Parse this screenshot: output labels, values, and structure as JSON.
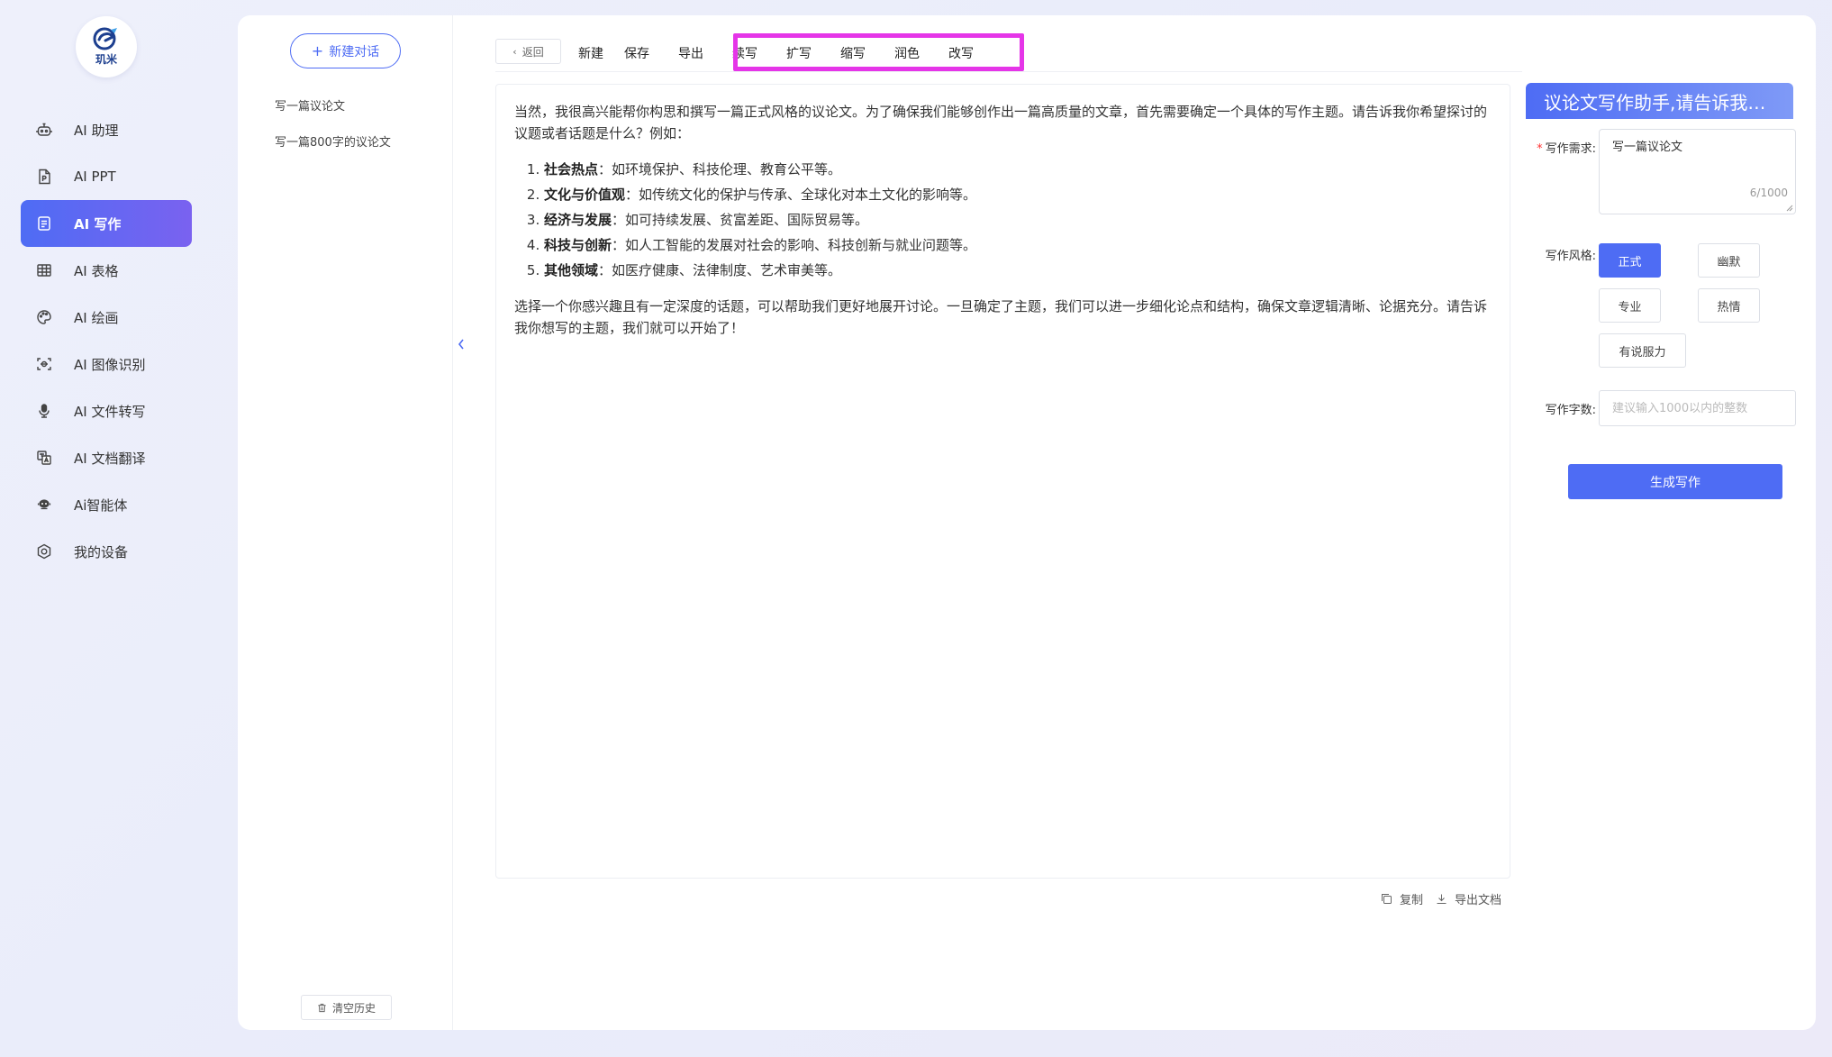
{
  "logo": {
    "text": "玑米"
  },
  "nav": {
    "items": [
      {
        "label": "AI 助理",
        "icon": "robot-icon"
      },
      {
        "label": "AI PPT",
        "icon": "ppt-file-icon"
      },
      {
        "label": "AI 写作",
        "icon": "document-edit-icon",
        "active": true
      },
      {
        "label": "AI 表格",
        "icon": "table-icon"
      },
      {
        "label": "AI 绘画",
        "icon": "palette-icon"
      },
      {
        "label": "AI 图像识别",
        "icon": "image-scan-icon"
      },
      {
        "label": "AI 文件转写",
        "icon": "microphone-file-icon"
      },
      {
        "label": "AI 文档翻译",
        "icon": "translate-icon"
      },
      {
        "label": "Ai智能体",
        "icon": "agent-icon"
      },
      {
        "label": "我的设备",
        "icon": "device-icon"
      }
    ]
  },
  "history": {
    "new_chat": "新建对话",
    "items": [
      "写一篇议论文",
      "写一篇800字的议论文"
    ],
    "clear": "清空历史"
  },
  "toolbar": {
    "back": "返回",
    "new": "新建",
    "save": "保存",
    "export": "导出",
    "continue": "续写",
    "expand": "扩写",
    "shorten": "缩写",
    "polish": "润色",
    "rewrite": "改写"
  },
  "document": {
    "intro": "当然，我很高兴能帮你构思和撰写一篇正式风格的议论文。为了确保我们能够创作出一篇高质量的文章，首先需要确定一个具体的写作主题。请告诉我你希望探讨的议题或者话题是什么？例如：",
    "list": [
      {
        "title": "社会热点",
        "text": "：如环境保护、科技伦理、教育公平等。"
      },
      {
        "title": "文化与价值观",
        "text": "：如传统文化的保护与传承、全球化对本土文化的影响等。"
      },
      {
        "title": "经济与发展",
        "text": "：如可持续发展、贫富差距、国际贸易等。"
      },
      {
        "title": "科技与创新",
        "text": "：如人工智能的发展对社会的影响、科技创新与就业问题等。"
      },
      {
        "title": "其他领域",
        "text": "：如医疗健康、法律制度、艺术审美等。"
      }
    ],
    "outro": "选择一个你感兴趣且有一定深度的话题，可以帮助我们更好地展开讨论。一旦确定了主题，我们可以进一步细化论点和结构，确保文章逻辑清晰、论据充分。请告诉我你想写的主题，我们就可以开始了！"
  },
  "doc_actions": {
    "copy": "复制",
    "export_doc": "导出文档"
  },
  "panel": {
    "title": "议论文写作助手,请告诉我写...",
    "req_label": "写作需求:",
    "req_value": "写一篇议论文",
    "req_count": "6/1000",
    "style_label": "写作风格:",
    "styles": [
      {
        "label": "正式",
        "selected": true
      },
      {
        "label": "幽默",
        "selected": false
      },
      {
        "label": "专业",
        "selected": false
      },
      {
        "label": "热情",
        "selected": false
      },
      {
        "label": "有说服力",
        "selected": false
      }
    ],
    "words_label": "写作字数:",
    "words_placeholder": "建议输入1000以内的整数",
    "generate": "生成写作"
  },
  "colors": {
    "accent": "#4e6cf4",
    "accent_gradient_end": "#7a62f0",
    "highlight_box": "#e535e8"
  }
}
